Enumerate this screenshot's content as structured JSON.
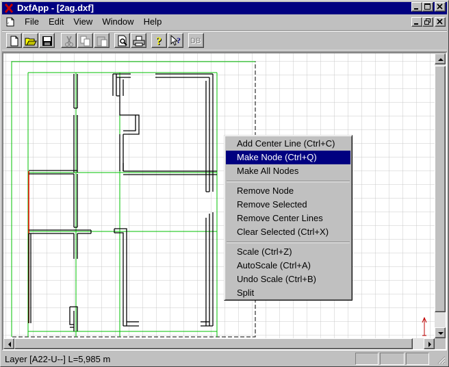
{
  "title": {
    "app_name": "DxfApp",
    "document": "[2ag.dxf]",
    "full": "DxfApp - [2ag.dxf]"
  },
  "menu": {
    "items": [
      {
        "label": "File",
        "mnemonic": "F"
      },
      {
        "label": "Edit",
        "mnemonic": "E"
      },
      {
        "label": "View",
        "mnemonic": "V"
      },
      {
        "label": "Window",
        "mnemonic": "W"
      },
      {
        "label": "Help",
        "mnemonic": "H"
      }
    ]
  },
  "toolbar": {
    "buttons": [
      {
        "name": "new-file-icon",
        "enabled": true
      },
      {
        "name": "open-folder-icon",
        "enabled": true
      },
      {
        "name": "save-icon",
        "enabled": true
      },
      {
        "name": "cut-icon",
        "enabled": false
      },
      {
        "name": "copy-icon",
        "enabled": false
      },
      {
        "name": "paste-icon",
        "enabled": false
      },
      {
        "name": "print-preview-icon",
        "enabled": true
      },
      {
        "name": "print-icon",
        "enabled": true
      },
      {
        "name": "help-icon",
        "enabled": true
      },
      {
        "name": "context-help-icon",
        "enabled": true
      },
      {
        "name": "db-icon",
        "enabled": false
      }
    ],
    "db_label": "DB"
  },
  "context_menu": {
    "groups": [
      [
        "Add Center Line (Ctrl+C)",
        "Make Node (Ctrl+Q)",
        "Make All Nodes"
      ],
      [
        "Remove Node",
        "Remove Selected",
        "Remove Center Lines",
        "Clear Selected (Ctrl+X)"
      ],
      [
        "Scale (Ctrl+Z)",
        "AutoScale (Ctrl+A)",
        "Undo Scale (Ctrl+B)",
        "Split"
      ]
    ],
    "selected": "Make Node (Ctrl+Q)"
  },
  "status": {
    "text": "Layer [A22-U--] L=5,985 m"
  },
  "colors": {
    "title_bar": "#000080",
    "grid": "#c8c8c8",
    "center_line": "#00c000",
    "selection": "#ff0000",
    "walls": "#000000",
    "border_dashed": "#000000"
  }
}
